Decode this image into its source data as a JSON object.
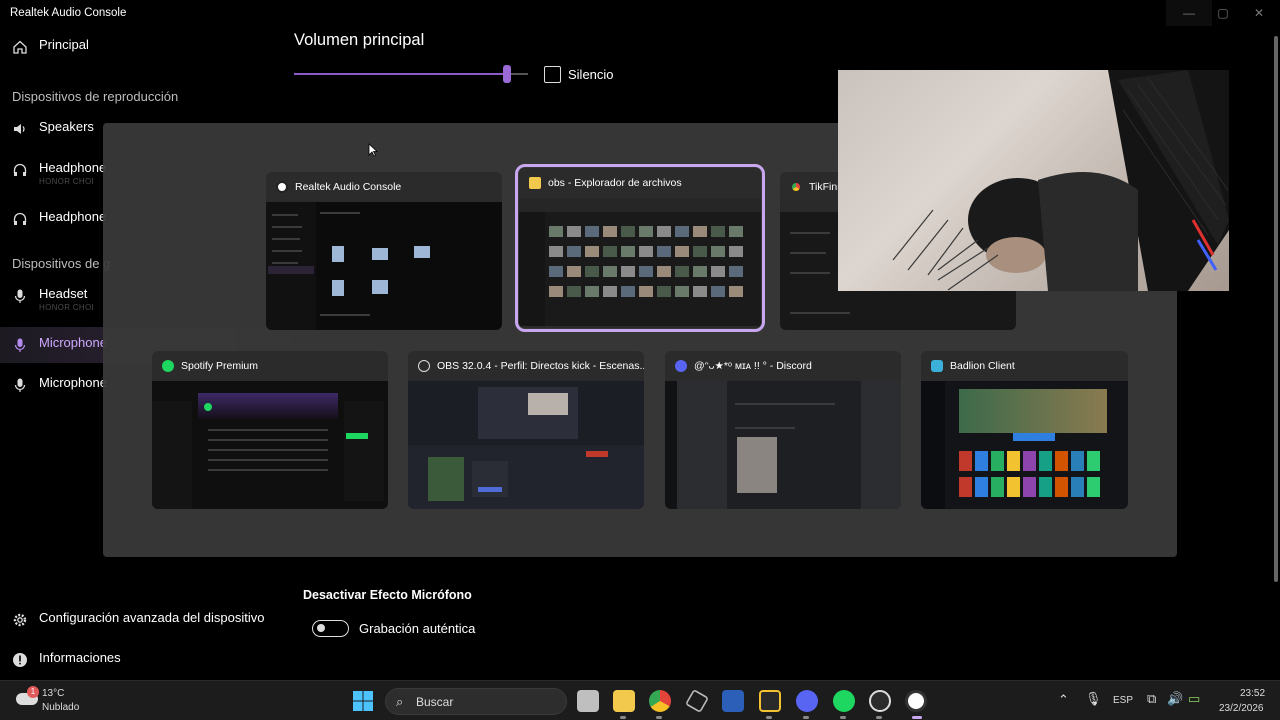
{
  "window": {
    "title": "Realtek Audio Console",
    "minimize": "—",
    "maximize": "▢",
    "close": "✕"
  },
  "sidebar": {
    "principal": "Principal",
    "section_playback": "Dispositivos de reproducción",
    "speakers": "Speakers",
    "headphones1": "Headphone",
    "headphones1_sub": "HONOR CHOI",
    "headphones2": "Headphone",
    "section_recording": "Dispositivos de g",
    "headset": "Headset",
    "headset_sub": "HONOR CHOI",
    "microphone1": "Microphone",
    "microphone2": "Microphone",
    "advanced": "Configuración avanzada del dispositivo",
    "info": "Informaciones"
  },
  "main": {
    "volume_title": "Volumen principal",
    "volume_level": 0.91,
    "mute_label": "Silencio",
    "effect_title": "Desactivar Efecto Micrófono",
    "toggle_label": "Grabación auténtica",
    "toggle_on": false
  },
  "switcher": {
    "cards": [
      {
        "title": "Realtek Audio Console",
        "icon": "realtek-icon",
        "color": "#ffffff"
      },
      {
        "title": "obs - Explorador de archivos",
        "icon": "folder-icon",
        "color": "#f2c94c"
      },
      {
        "title": "TikFini",
        "icon": "chrome-icon",
        "color": "#e5443b"
      },
      {
        "title": "Spotify Premium",
        "icon": "spotify-icon",
        "color": "#1ed760"
      },
      {
        "title": "OBS 32.0.4 - Perfil: Directos kick - Escenas...",
        "icon": "obs-icon",
        "color": "#ffffff"
      },
      {
        "title": "@ᵔᴗ★*ᵒ ᴍɪᴀ !! ° - Discord",
        "icon": "discord-icon",
        "color": "#5865f2"
      },
      {
        "title": "Badlion Client",
        "icon": "badlion-icon",
        "color": "#3bb0d9"
      }
    ]
  },
  "taskbar": {
    "weather_temp": "13°C",
    "weather_desc": "Nublado",
    "weather_badge": "1",
    "search_label": "Buscar",
    "lang": "ESP",
    "time": "23:52",
    "date": "23/2/2026"
  },
  "colors": {
    "accent": "#9a6ad6",
    "selected_outline": "#c8a6f0"
  }
}
